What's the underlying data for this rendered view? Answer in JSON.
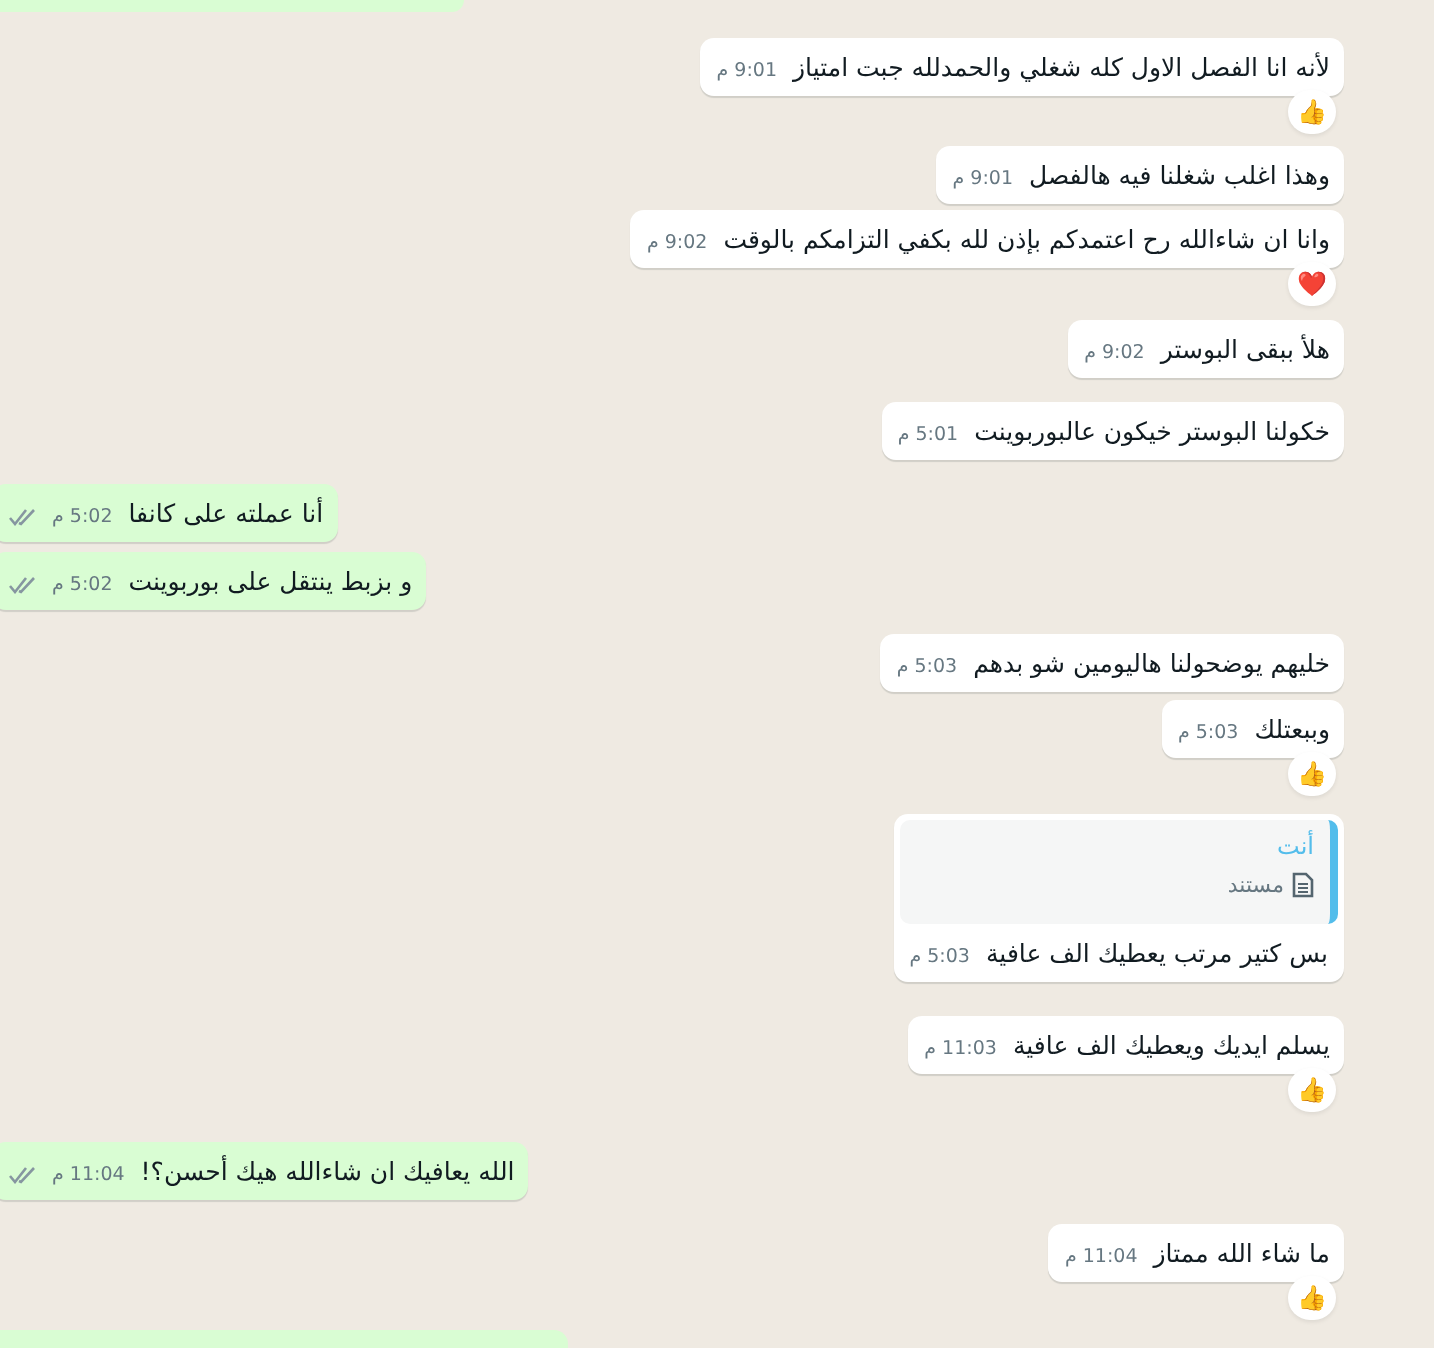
{
  "messages": [
    {
      "kind": "in",
      "text": "لأنه انا الفصل الاول كله شغلي والحمدلله جبت امتياز",
      "time": "9:01 م",
      "reaction": "👍"
    },
    {
      "kind": "in",
      "text": "وهذا اغلب شغلنا فيه هالفصل",
      "time": "9:01 م"
    },
    {
      "kind": "in",
      "text": "وانا ان شاءالله رح اعتمدكم بإذن لله بكفي التزامكم بالوقت",
      "time": "9:02 م",
      "reaction": "❤️"
    },
    {
      "kind": "in",
      "text": "هلأ ببقى البوستر",
      "time": "9:02 م"
    },
    {
      "kind": "in",
      "text": "خكولنا البوستر خيكون عالبوربوينت",
      "time": "5:01 م"
    },
    {
      "kind": "out",
      "text": "أنا عملته على كانفا",
      "time": "5:02 م"
    },
    {
      "kind": "out",
      "text": "و بزبط ينتقل على بوربوينت",
      "time": "5:02 م"
    },
    {
      "kind": "in",
      "text": "خليهم يوضحولنا هاليومين شو بدهم",
      "time": "5:03 م"
    },
    {
      "kind": "in",
      "text": "وببعتلك",
      "time": "5:03 م",
      "reaction": "👍"
    },
    {
      "kind": "in",
      "text": "بس كتير مرتب يعطيك الف عافية",
      "time": "5:03 م",
      "quote": {
        "author": "أنت",
        "label": "مستند"
      }
    },
    {
      "kind": "in",
      "text": "يسلم ايديك ويعطيك الف عافية",
      "time": "11:03 م",
      "reaction": "👍"
    },
    {
      "kind": "out",
      "text": "الله يعافيك ان شاءالله هيك أحسن؟!",
      "time": "11:04 م"
    },
    {
      "kind": "in",
      "text": "ما شاء الله ممتاز",
      "time": "11:04 م",
      "reaction": "👍"
    }
  ]
}
